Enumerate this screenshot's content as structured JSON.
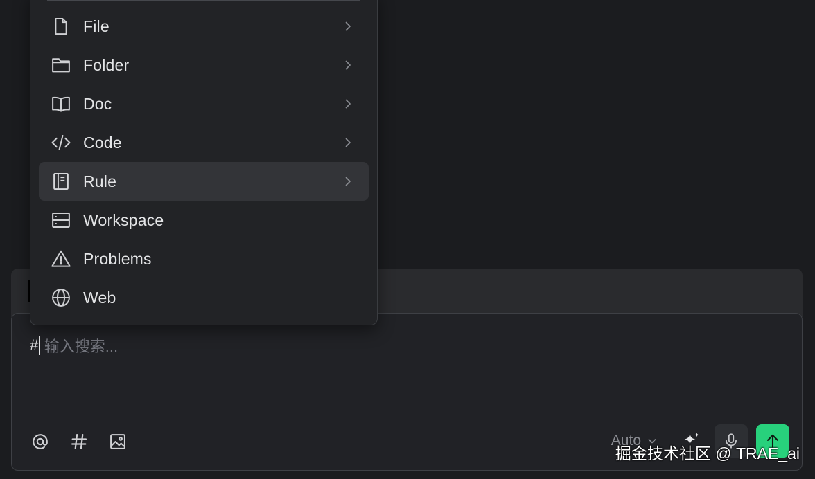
{
  "menu": {
    "items": [
      {
        "label": "File",
        "icon": "file-icon",
        "has_submenu": true
      },
      {
        "label": "Folder",
        "icon": "folder-icon",
        "has_submenu": true
      },
      {
        "label": "Doc",
        "icon": "book-icon",
        "has_submenu": true
      },
      {
        "label": "Code",
        "icon": "code-icon",
        "has_submenu": true
      },
      {
        "label": "Rule",
        "icon": "rule-icon",
        "has_submenu": true,
        "highlighted": true
      },
      {
        "label": "Workspace",
        "icon": "workspace-icon",
        "has_submenu": false
      },
      {
        "label": "Problems",
        "icon": "warning-icon",
        "has_submenu": false
      },
      {
        "label": "Web",
        "icon": "globe-icon",
        "has_submenu": false
      }
    ]
  },
  "input": {
    "prefix": "#",
    "placeholder": "输入搜索..."
  },
  "toolbar": {
    "mention_icon": "at-icon",
    "hash_icon": "hash-icon",
    "image_icon": "image-icon",
    "model_label": "Auto",
    "sparkle_icon": "sparkle-icon",
    "mic_icon": "mic-icon",
    "send_icon": "arrow-up-icon"
  },
  "watermark": "掘金技术社区 @ TRAE_ai",
  "colors": {
    "background": "#1b1c1f",
    "menu_bg": "#222326",
    "highlight_bg": "#333438",
    "send_button": "#28d17c"
  }
}
